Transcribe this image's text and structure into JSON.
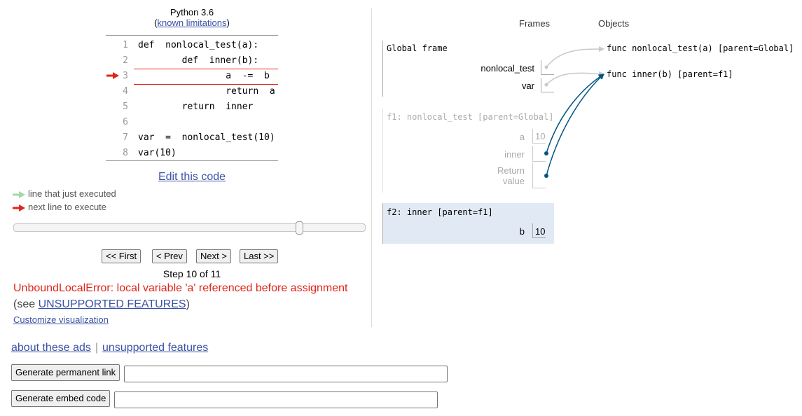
{
  "header": {
    "python_version": "Python 3.6",
    "limitations_open": "(",
    "limitations_link": "known limitations",
    "limitations_close": ")"
  },
  "code": {
    "lines": [
      {
        "no": "1",
        "text": "def  nonlocal_test(a):"
      },
      {
        "no": "2",
        "text": "        def  inner(b):"
      },
      {
        "no": "3",
        "text": "                a  -=  b"
      },
      {
        "no": "4",
        "text": "                return  a"
      },
      {
        "no": "5",
        "text": "        return  inner"
      },
      {
        "no": "6",
        "text": ""
      },
      {
        "no": "7",
        "text": "var  =  nonlocal_test(10)"
      },
      {
        "no": "8",
        "text": "var(10)"
      }
    ],
    "active_line": 3,
    "edit_link": "Edit this code"
  },
  "legend": {
    "executed": "line that just executed",
    "next": "next line to execute",
    "executed_color": "#a6d8a6",
    "next_color": "#e0251b"
  },
  "slider": {
    "step": 10,
    "total": 11
  },
  "nav": {
    "first": "<< First",
    "prev": "< Prev",
    "next": "Next >",
    "last": "Last >>"
  },
  "status": {
    "step_text": "Step 10 of 11",
    "error": "UnboundLocalError: local variable 'a' referenced before assignment",
    "see_open": "(see ",
    "see_link": "UNSUPPORTED FEATURES",
    "see_close": ")",
    "customize": "Customize visualization"
  },
  "viz": {
    "frames_header": "Frames",
    "objects_header": "Objects",
    "global_frame": {
      "title": "Global frame",
      "vars": [
        {
          "name": "nonlocal_test"
        },
        {
          "name": "var"
        }
      ]
    },
    "f1": {
      "title": "f1: nonlocal_test [parent=Global]",
      "vars": [
        {
          "name": "a",
          "value": "10"
        },
        {
          "name": "inner"
        },
        {
          "name": "Return\nvalue"
        }
      ]
    },
    "f2": {
      "title": "f2: inner [parent=f1]",
      "vars": [
        {
          "name": "b",
          "value": "10"
        }
      ]
    },
    "objects": [
      {
        "label": "func nonlocal_test(a) [parent=Global]"
      },
      {
        "label": "func inner(b) [parent=f1]"
      }
    ],
    "arrow_gray": "#c8c8c8",
    "arrow_blue": "#005583",
    "f2_bg": "#e1e9f4"
  },
  "footer": {
    "about_ads": "about these ads",
    "separator": "|",
    "unsupported": "unsupported features",
    "perm_link_btn": "Generate permanent link",
    "embed_btn": "Generate embed code"
  }
}
